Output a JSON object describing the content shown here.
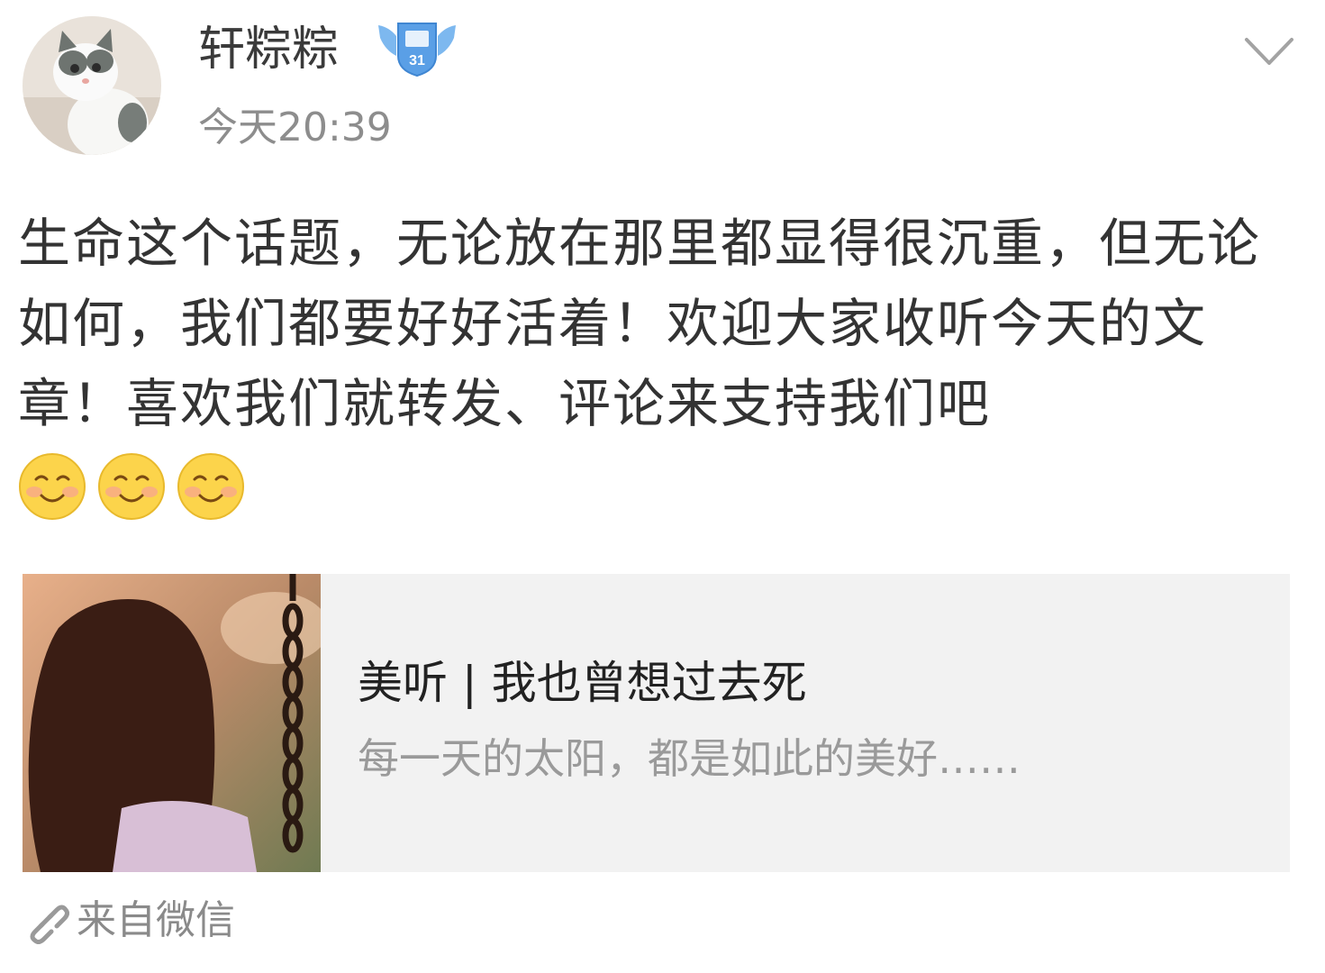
{
  "author": {
    "username": "轩粽粽",
    "timestamp": "今天20:39",
    "badge_icon": "winged-shield-badge-icon",
    "avatar_icon": "cat-avatar"
  },
  "post": {
    "text": "生命这个话题，无论放在那里都显得很沉重，但无论如何，我们都要好好活着！欢迎大家收听今天的文章！喜欢我们就转发、评论来支持我们吧",
    "emojis": [
      "smile-emoji",
      "smile-emoji",
      "smile-emoji"
    ]
  },
  "card": {
    "title": "美听 | 我也曾想过去死",
    "description": "每一天的太阳，都是如此的美好……"
  },
  "source": {
    "label": "来自微信",
    "icon": "link-icon"
  },
  "colors": {
    "text": "#333333",
    "meta": "#8d8d8d",
    "card_bg": "#f2f2f2",
    "emoji_yellow": "#fcd44b",
    "badge_blue": "#5a9fe6"
  }
}
